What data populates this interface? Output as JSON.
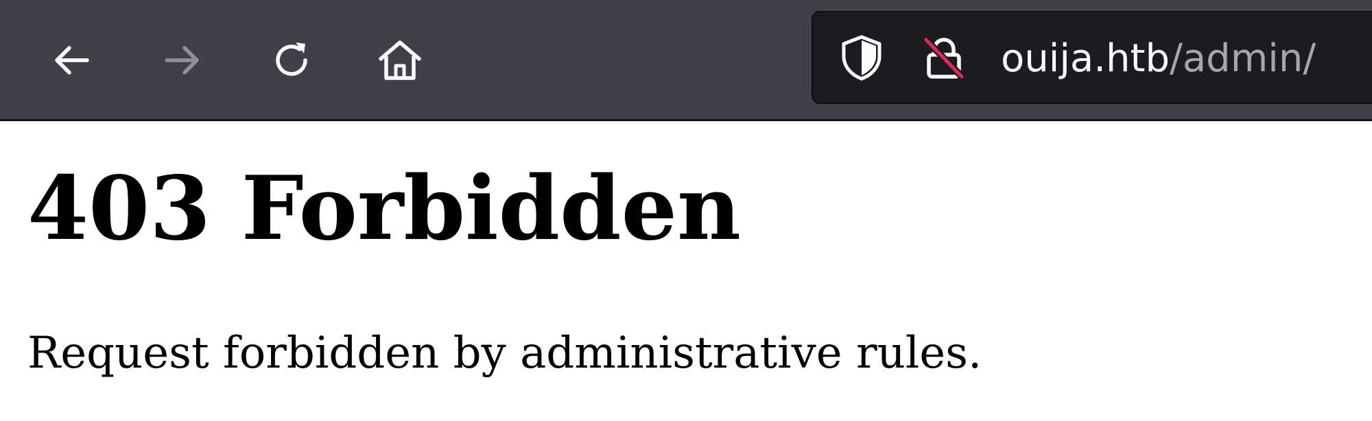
{
  "browser": {
    "nav": {
      "back_icon": "arrow-left-icon",
      "forward_icon": "arrow-right-icon",
      "forward_enabled": false,
      "reload_icon": "reload-icon",
      "home_icon": "home-icon"
    },
    "urlbar": {
      "host": "ouija.htb",
      "path": "/admin/",
      "shield_icon": "shield-icon",
      "lock_icon": "insecure-lock-icon"
    },
    "colors": {
      "toolbar_bg": "#3f4048",
      "urlbar_bg": "#1c1b22",
      "icon": "#fbfbfe",
      "icon_disabled": "#8f8f9d",
      "insecure_strike": "#e22850"
    }
  },
  "page": {
    "title": "403 Forbidden",
    "message": "Request forbidden by administrative rules."
  }
}
